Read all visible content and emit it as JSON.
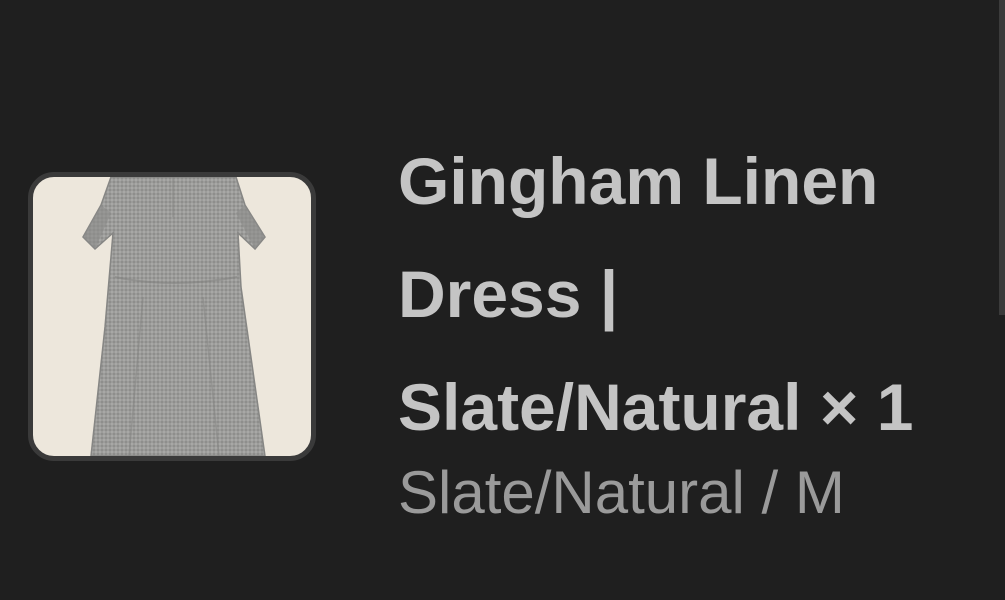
{
  "line_item": {
    "title_line1": "Gingham Linen",
    "title_line2": "Dress |",
    "title_line3": "Slate/Natural × 1",
    "variant": "Slate/Natural / M"
  },
  "colors": {
    "background": "#1f1f1f",
    "title": "#c4c4c4",
    "variant": "#9a9a9a",
    "thumbnail_bg": "#ede7dc",
    "thumbnail_border": "#3a3a3a",
    "dress": "#9b9b99"
  }
}
